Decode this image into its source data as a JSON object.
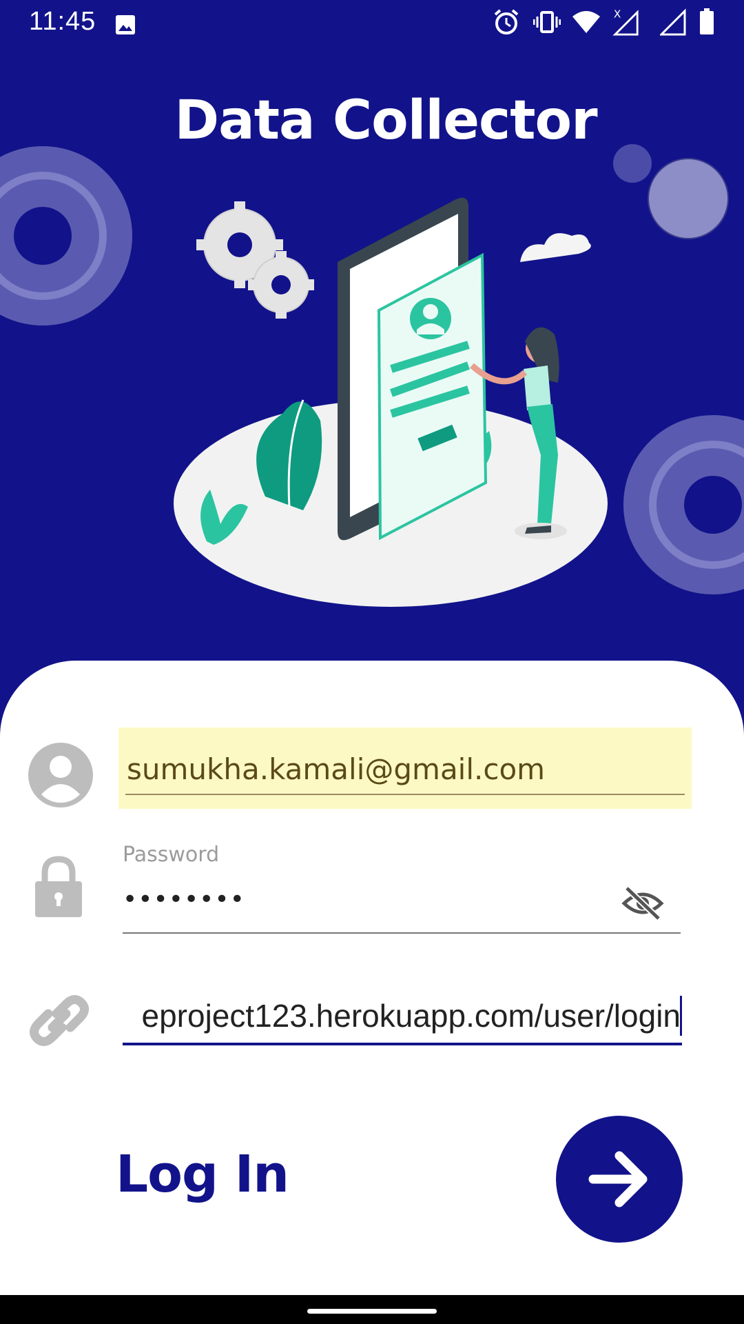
{
  "status_bar": {
    "time": "11:45",
    "icons": [
      "image-icon",
      "alarm-icon",
      "vibrate-icon",
      "wifi-icon",
      "signal-no-data-icon",
      "signal-icon",
      "battery-icon"
    ],
    "no_data_mark": "X"
  },
  "header": {
    "title": "Data Collector"
  },
  "login_form": {
    "email": {
      "value": "sumukha.kamali@gmail.com",
      "autofill_background": "#fdf9c4"
    },
    "password": {
      "label": "Password",
      "value": "••••••••"
    },
    "server_url": {
      "value": "eproject123.herokuapp.com/user/login"
    },
    "login_label": "Log In"
  },
  "colors": {
    "primary": "#12138a",
    "card": "#ffffff",
    "illustration_teal": "#2bc4a0",
    "icon_gray": "#bdbdbd"
  }
}
